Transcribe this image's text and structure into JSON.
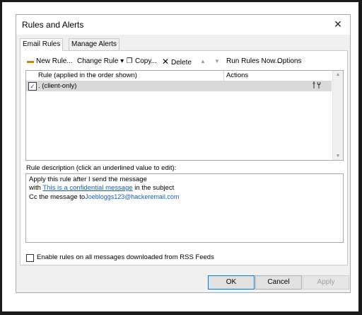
{
  "window": {
    "title": "Rules and Alerts",
    "close_glyph": "✕"
  },
  "tabs": [
    {
      "label": "Email Rules",
      "active": true
    },
    {
      "label": "Manage Alerts",
      "active": false
    }
  ],
  "toolbar": {
    "new_rule": "New Rule...",
    "change_rule": "Change Rule ▾",
    "copy": "Copy...",
    "delete": "Delete",
    "move_up": "▲",
    "move_down": "▼",
    "run_rules": "Run Rules Now...",
    "options": "Options"
  },
  "rules_table": {
    "columns": [
      "Rule (applied in the order shown)",
      "Actions"
    ],
    "rows": [
      {
        "checked": true,
        "name": ".  (client-only)",
        "action_icon": "settings-icon"
      }
    ]
  },
  "description": {
    "label": "Rule description (click an underlined value to edit):",
    "line1": "Apply this rule after I send the message",
    "line2_prefix": "with ",
    "line2_link": "This is a confidential message",
    "line2_suffix": " in the subject",
    "line3_prefix": "Cc the message to",
    "line3_address": "Joebloggs123@hackeremail.com"
  },
  "rss": {
    "label": "Enable rules on all messages downloaded from RSS Feeds",
    "checked": false
  },
  "buttons": {
    "ok": "OK",
    "cancel": "Cancel",
    "apply": "Apply"
  },
  "colors": {
    "link": "#1a5fb4",
    "selected_row": "#d9d9d9",
    "dialog_bg": "#f0f0f0"
  }
}
